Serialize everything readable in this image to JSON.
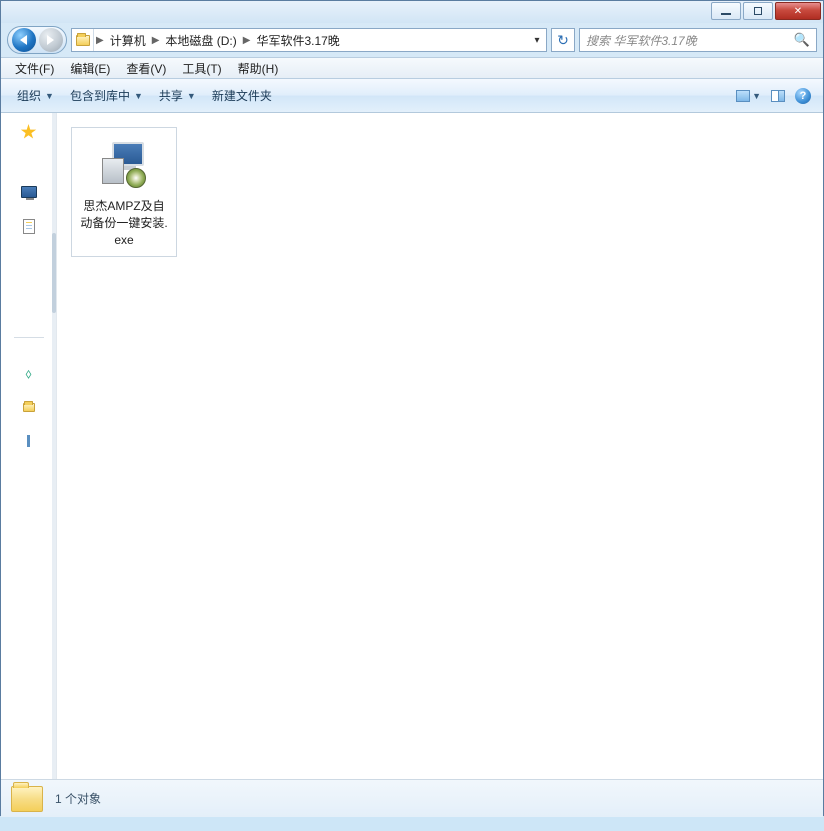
{
  "window": {
    "controls": {
      "min": "minimize",
      "max": "maximize",
      "close": "close"
    }
  },
  "nav": {
    "back_enabled": true,
    "forward_enabled": false
  },
  "breadcrumb": {
    "items": [
      "计算机",
      "本地磁盘 (D:)",
      "华军软件3.17晚"
    ]
  },
  "search": {
    "placeholder": "搜索 华军软件3.17晚"
  },
  "menubar": {
    "items": [
      "文件(F)",
      "编辑(E)",
      "查看(V)",
      "工具(T)",
      "帮助(H)"
    ]
  },
  "toolbar": {
    "organize": "组织",
    "include": "包含到库中",
    "share": "共享",
    "newfolder": "新建文件夹"
  },
  "content": {
    "files": [
      {
        "name": "思杰AMPZ及自动备份一键安装.exe",
        "type": "exe"
      }
    ]
  },
  "statusbar": {
    "text": "1 个对象"
  }
}
